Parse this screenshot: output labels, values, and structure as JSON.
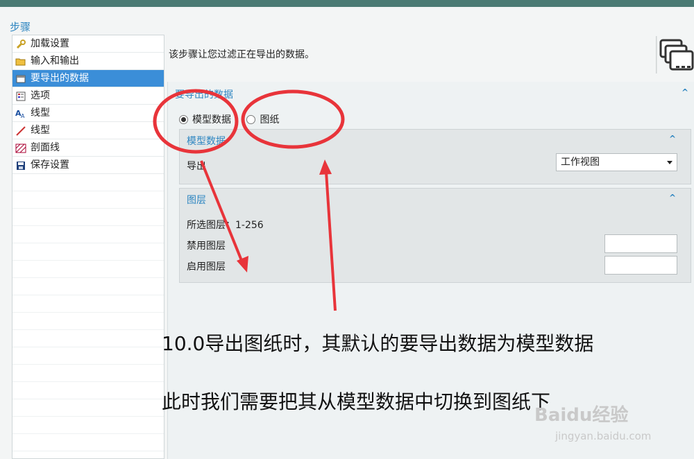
{
  "panel": {
    "title": "步骤"
  },
  "steps": [
    {
      "label": "加载设置",
      "icon": "wrench-icon"
    },
    {
      "label": "输入和输出",
      "icon": "folder-open-icon"
    },
    {
      "label": "要导出的数据",
      "icon": "export-data-icon",
      "selected": true
    },
    {
      "label": "选项",
      "icon": "options-list-icon"
    },
    {
      "label": "线型",
      "icon": "text-font-icon"
    },
    {
      "label": "线型",
      "icon": "line-style-icon"
    },
    {
      "label": "剖面线",
      "icon": "hatch-icon"
    },
    {
      "label": "保存设置",
      "icon": "save-icon"
    }
  ],
  "main": {
    "description": "该步骤让您过滤正在导出的数据。",
    "section_title": "要导出的数据",
    "radio_model": "模型数据",
    "radio_drawing": "图纸",
    "model_group": {
      "title": "模型数据",
      "export_label": "导出",
      "export_value": "工作视图"
    },
    "layer_group": {
      "title": "图层",
      "selected_layers": "所选图层：1-256",
      "disabled_label": "禁用图层",
      "enabled_label": "启用图层"
    }
  },
  "annotation": {
    "line1": "10.0导出图纸时，其默认的要导出数据为模型数据",
    "line2": "此时我们需要把其从模型数据中切换到图纸下"
  },
  "watermark": {
    "brand": "Baidu经验",
    "url": "jingyan.baidu.com"
  },
  "colors": {
    "accent": "#2e86c1",
    "selected": "#3b8ed8",
    "annotation": "#e8343a"
  }
}
